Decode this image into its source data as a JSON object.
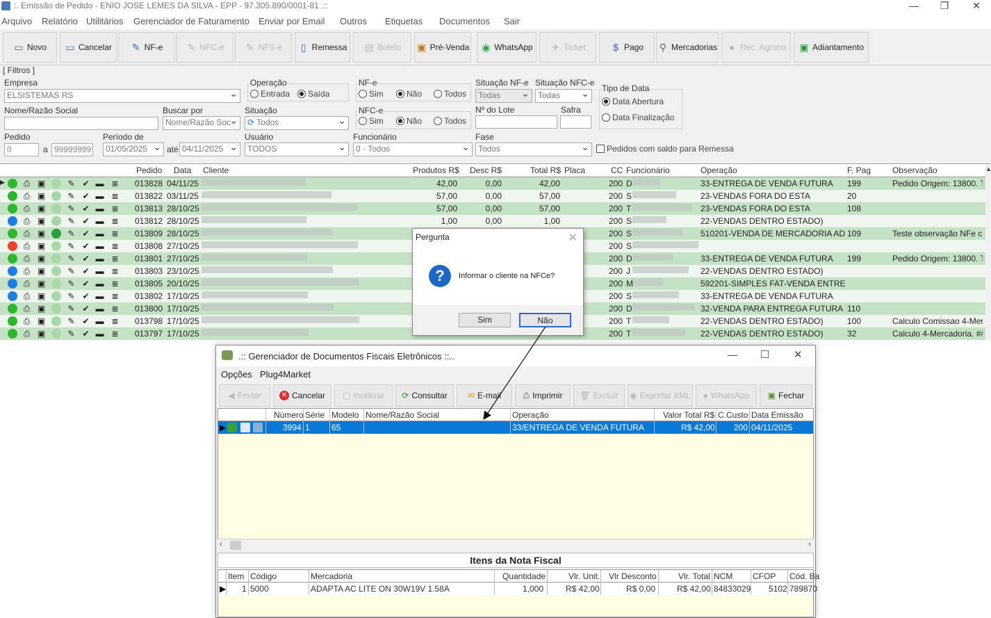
{
  "window": {
    "title": ":. Emissão de Pedido - ENIO JOSE LEMES DA SILVA - EPP - 97.305.890/0001-81 .::"
  },
  "menu": [
    "Arquivo",
    "Relatório",
    "Utilitários",
    "Gerenciador de Faturamento",
    "Enviar por Email",
    "Outros",
    "Etiquetas",
    "Documentos",
    "Sair"
  ],
  "toolbar": [
    {
      "label": "Novo",
      "icon": "new-document-icon",
      "enabled": true
    },
    {
      "label": "Cancelar",
      "icon": "cancel-document-icon",
      "enabled": true
    },
    {
      "label": "NF-e",
      "icon": "nfe-icon",
      "enabled": true
    },
    {
      "label": "NFC-e",
      "icon": "nfce-icon",
      "enabled": false
    },
    {
      "label": "NFS-e",
      "icon": "nfse-icon",
      "enabled": false
    },
    {
      "label": "Remessa",
      "icon": "remessa-icon",
      "enabled": true
    },
    {
      "label": "Boleto",
      "icon": "boleto-icon",
      "enabled": false
    },
    {
      "label": "Pré-Venda",
      "icon": "pre-venda-icon",
      "enabled": true
    },
    {
      "label": "WhatsApp",
      "icon": "whatsapp-icon",
      "enabled": true
    },
    {
      "label": "Ticket",
      "icon": "ticket-icon",
      "enabled": false
    },
    {
      "label": "Pago",
      "icon": "dollar-icon",
      "enabled": true
    },
    {
      "label": "Mercadorias",
      "icon": "search-icon",
      "enabled": true
    },
    {
      "label": "Rec. Agrono",
      "icon": "agronomy-icon",
      "enabled": false
    },
    {
      "label": "Adiantamento",
      "icon": "adiantamento-icon",
      "enabled": true
    }
  ],
  "filters": {
    "group_label": "[ Filtros ]",
    "empresa_label": "Empresa",
    "empresa_value": "ELSISTEMAS RS",
    "operacao_label": "Operação",
    "operacao_options": [
      "Entrada",
      "Saída"
    ],
    "operacao_selected": "Saída",
    "nfe_label": "NF-e",
    "nfe_options": [
      "Sim",
      "Não",
      "Todos"
    ],
    "nfe_selected": "Não",
    "situacao_nfe_label": "Situação NF-e",
    "situacao_nfe_value": "Todas",
    "situacao_nfce_label": "Situação NFC-e",
    "situacao_nfce_value": "Todas",
    "tipo_data_label": "Tipo de Data",
    "tipo_data_options": [
      "Data Abertura",
      "Data Finalização"
    ],
    "tipo_data_selected": "Data Abertura",
    "nome_label": "Nome/Razão Social",
    "nome_value": "",
    "buscar_label": "Buscar por",
    "buscar_value": "Nome/Razão Soc",
    "situacao_label": "Situação",
    "situacao_value": "Todos",
    "nfce_label": "NFC-e",
    "nfce_options": [
      "Sim",
      "Não",
      "Todos"
    ],
    "nfce_selected": "Não",
    "lote_label": "Nº do Lote",
    "lote_value": "",
    "safra_label": "Safra",
    "safra_value": "",
    "pedido_label": "Pedido",
    "pedido_from": "0",
    "pedido_sep": "a",
    "pedido_to": "99999999",
    "periodo_label": "Período de",
    "periodo_from": "01/05/2025",
    "periodo_sep": "até",
    "periodo_to": "04/11/2025",
    "usuario_label": "Usuário",
    "usuario_value": "TODOS",
    "funcionario_label": "Funcionário",
    "funcionario_value": "0 - Todos",
    "fase_label": "Fase",
    "fase_value": "Todos",
    "saldo_label": "Pedidos com saldo para Remessa"
  },
  "grid": {
    "columns": [
      "Pedido",
      "Data",
      "Cliente",
      "Produtos R$",
      "Desc R$",
      "Total R$",
      "Placa",
      "CC",
      "Funcionário",
      "Operação",
      "F. Pag",
      "Observação"
    ],
    "rows": [
      {
        "status": "green",
        "pedido": "013828",
        "data": "04/11/25",
        "produtos": "42,00",
        "desc": "0,00",
        "total": "42,00",
        "cc": "200",
        "func": "D",
        "operacao": "33-ENTREGA DE VENDA FUTURA",
        "fpag": "199",
        "obs": "Pedido Origem: 13800. Te"
      },
      {
        "status": "green",
        "pedido": "013822",
        "data": "03/11/25",
        "produtos": "57,00",
        "desc": "0,00",
        "total": "57,00",
        "cc": "200",
        "func": "S",
        "operacao": "23-VENDAS FORA DO ESTA",
        "fpag": "20",
        "obs": ""
      },
      {
        "status": "green",
        "pedido": "013813",
        "data": "28/10/25",
        "produtos": "57,00",
        "desc": "0,00",
        "total": "57,00",
        "cc": "200",
        "func": "T",
        "operacao": "23-VENDAS FORA DO ESTA",
        "fpag": "108",
        "obs": ""
      },
      {
        "status": "blue",
        "pedido": "013812",
        "data": "28/10/25",
        "produtos": "1,00",
        "desc": "0,00",
        "total": "1,00",
        "cc": "200",
        "func": "S",
        "operacao": "22-VENDAS DENTRO ESTADO)",
        "fpag": "",
        "obs": ""
      },
      {
        "status": "green",
        "pedido": "013809",
        "data": "28/10/25",
        "produtos": "",
        "desc": "",
        "total": "",
        "cc": "200",
        "func": "S",
        "operacao": "510201-VENDA DE MERCADORIA ADQUI",
        "fpag": "109",
        "obs": "Teste observação NFe cc"
      },
      {
        "status": "red",
        "pedido": "013808",
        "data": "27/10/25",
        "produtos": "",
        "desc": "",
        "total": "",
        "cc": "200",
        "func": "S",
        "operacao": "",
        "fpag": "",
        "obs": ""
      },
      {
        "status": "green",
        "pedido": "013801",
        "data": "27/10/25",
        "produtos": "",
        "desc": "",
        "total": "",
        "cc": "200",
        "func": "D",
        "operacao": "33-ENTREGA DE VENDA FUTURA",
        "fpag": "199",
        "obs": "Pedido Origem: 13800. Te"
      },
      {
        "status": "blue",
        "pedido": "013803",
        "data": "23/10/25",
        "produtos": "",
        "desc": "",
        "total": "",
        "cc": "200",
        "func": "J",
        "operacao": "22-VENDAS DENTRO ESTADO)",
        "fpag": "",
        "obs": ""
      },
      {
        "status": "blue",
        "pedido": "013805",
        "data": "20/10/25",
        "produtos": "",
        "desc": "",
        "total": "",
        "cc": "200",
        "func": "M",
        "operacao": "592201-SIMPLES FAT-VENDA ENTREGA",
        "fpag": "",
        "obs": ""
      },
      {
        "status": "blue",
        "pedido": "013802",
        "data": "17/10/25",
        "produtos": "",
        "desc": "",
        "total": "",
        "cc": "200",
        "func": "S",
        "operacao": "33-ENTREGA DE VENDA FUTURA",
        "fpag": "",
        "obs": ""
      },
      {
        "status": "green",
        "pedido": "013800",
        "data": "17/10/25",
        "produtos": "",
        "desc": "",
        "total": "",
        "cc": "200",
        "func": "D",
        "operacao": "32-VENDA PARA ENTREGA FUTURA",
        "fpag": "110",
        "obs": ""
      },
      {
        "status": "green",
        "pedido": "013798",
        "data": "17/10/25",
        "produtos": "",
        "desc": "",
        "total": "",
        "cc": "200",
        "func": "T",
        "operacao": "22-VENDAS DENTRO ESTADO)",
        "fpag": "100",
        "obs": "Calculo Comissao 4-Merc"
      },
      {
        "status": "green",
        "pedido": "013797",
        "data": "17/10/25",
        "produtos": "",
        "desc": "",
        "total": "",
        "cc": "200",
        "func": "T",
        "operacao": "22-VENDAS DENTRO ESTADO)",
        "fpag": "32",
        "obs": "Calculo 4-Mercadoria. ###"
      }
    ]
  },
  "dialog": {
    "title": "Pergunta",
    "message": "Informar o cliente na NFCe?",
    "yes": "Sim",
    "no": "Não"
  },
  "nfe_window": {
    "title": ".:: Gerenciador de Documentos Fiscais Eletrônicos ::..",
    "menu": [
      "Opções",
      "Plug4Market"
    ],
    "toolbar": [
      {
        "label": "Enviar",
        "icon": "send-icon",
        "enabled": false
      },
      {
        "label": "Cancelar",
        "icon": "cancel-icon",
        "enabled": true
      },
      {
        "label": "Inutilizar",
        "icon": "inutilizar-icon",
        "enabled": false
      },
      {
        "label": "Consultar",
        "icon": "consultar-icon",
        "enabled": true
      },
      {
        "label": "E-mail",
        "icon": "email-icon",
        "enabled": true
      },
      {
        "label": "Imprimir",
        "icon": "printer-icon",
        "enabled": true
      },
      {
        "label": "Excluir",
        "icon": "trash-icon",
        "enabled": false
      },
      {
        "label": "Exportar XML",
        "icon": "export-icon",
        "enabled": false
      },
      {
        "label": "WhatsApp",
        "icon": "whatsapp-icon",
        "enabled": false
      },
      {
        "label": "Fechar",
        "icon": "exit-icon",
        "enabled": true
      }
    ],
    "columns": [
      "Número",
      "Série",
      "Modelo",
      "Nome/Razão Social",
      "Operação",
      "Valor Total R$",
      "C.Custo",
      "Data Emissão"
    ],
    "row": {
      "numero": "3994",
      "serie": "1",
      "modelo": "65",
      "nome": "",
      "operacao": "33/ENTREGA DE VENDA FUTURA",
      "valor": "R$ 42,00",
      "ccusto": "200",
      "data": "04/11/2025"
    },
    "itens_title": "Itens da Nota Fiscal",
    "itens_columns": [
      "Item",
      "Código",
      "Mercadoria",
      "Quantidade",
      "Vlr. Unit.",
      "Vlr Desconto",
      "Vlr. Total",
      "NCM",
      "CFOP",
      "Cód. Ba"
    ],
    "itens_row": {
      "item": "1",
      "codigo": "5000",
      "mercadoria": "ADAPTA AC LITE ON 30W19V 1.58A",
      "quantidade": "1,000",
      "unit": "R$ 42,00",
      "desconto": "R$ 0,00",
      "total": "R$ 42,00",
      "ncm": "84833029",
      "cfop": "5102",
      "codba": "789870"
    }
  },
  "colors": {
    "green_status": "#2fb52f",
    "blue_status": "#1f7fe0",
    "red_status": "#e6452a",
    "row_green": "#c6e2c6",
    "selection": "#0a78d7"
  }
}
